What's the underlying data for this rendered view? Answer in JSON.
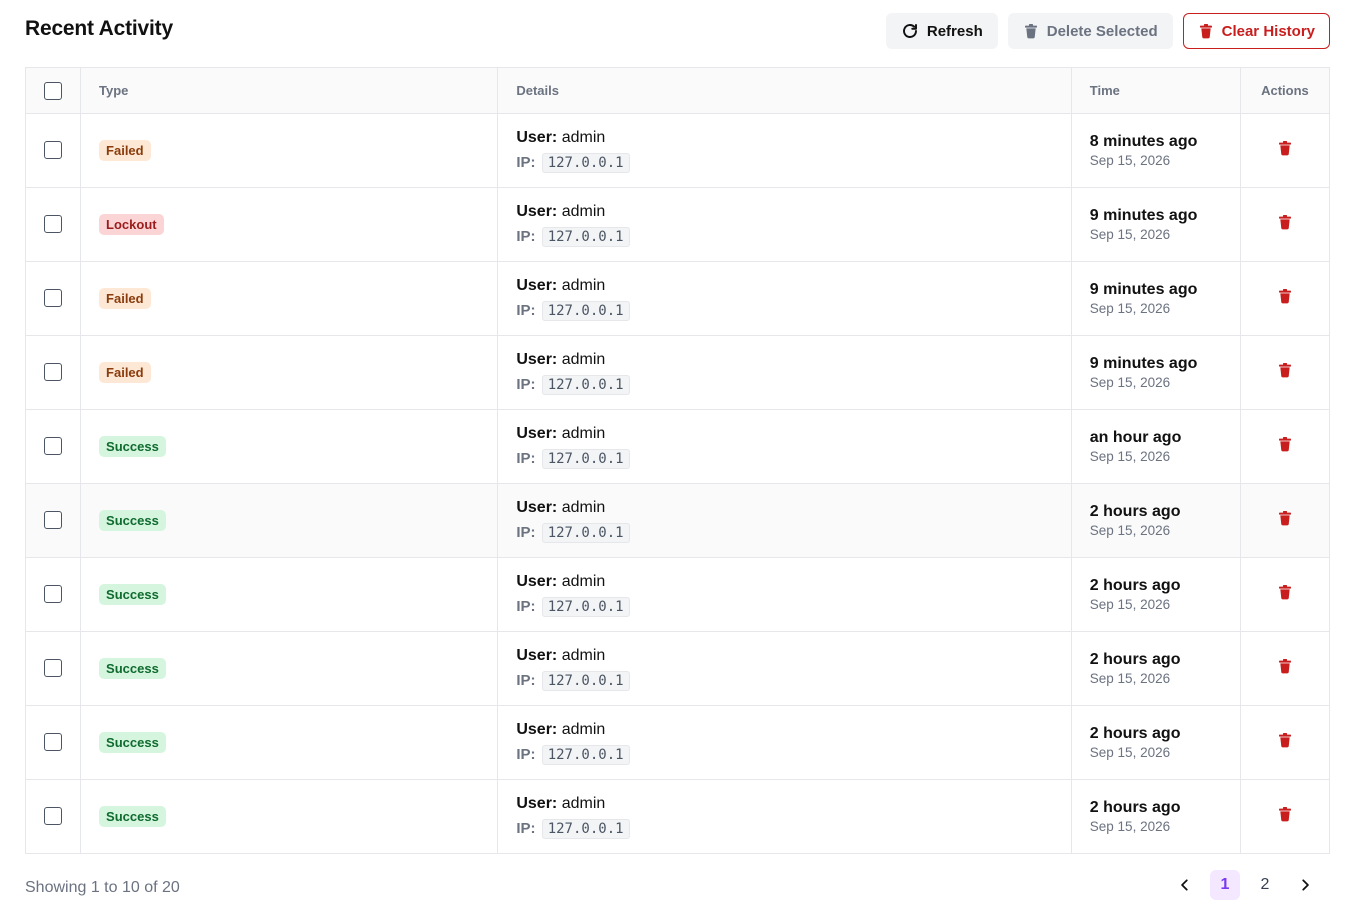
{
  "header": {
    "title": "Recent Activity",
    "refresh_label": "Refresh",
    "delete_selected_label": "Delete Selected",
    "clear_history_label": "Clear History"
  },
  "columns": {
    "type": "Type",
    "details": "Details",
    "time": "Time",
    "actions": "Actions"
  },
  "labels": {
    "user": "User:",
    "ip": "IP:"
  },
  "rows": [
    {
      "type": "Failed",
      "status": "failed",
      "user": "admin",
      "ip": "127.0.0.1",
      "relative": "8 minutes ago",
      "date": "Sep 15, 2026"
    },
    {
      "type": "Lockout",
      "status": "lockout",
      "user": "admin",
      "ip": "127.0.0.1",
      "relative": "9 minutes ago",
      "date": "Sep 15, 2026"
    },
    {
      "type": "Failed",
      "status": "failed",
      "user": "admin",
      "ip": "127.0.0.1",
      "relative": "9 minutes ago",
      "date": "Sep 15, 2026"
    },
    {
      "type": "Failed",
      "status": "failed",
      "user": "admin",
      "ip": "127.0.0.1",
      "relative": "9 minutes ago",
      "date": "Sep 15, 2026"
    },
    {
      "type": "Success",
      "status": "success",
      "user": "admin",
      "ip": "127.0.0.1",
      "relative": "an hour ago",
      "date": "Sep 15, 2026"
    },
    {
      "type": "Success",
      "status": "success",
      "user": "admin",
      "ip": "127.0.0.1",
      "relative": "2 hours ago",
      "date": "Sep 15, 2026",
      "highlighted": true
    },
    {
      "type": "Success",
      "status": "success",
      "user": "admin",
      "ip": "127.0.0.1",
      "relative": "2 hours ago",
      "date": "Sep 15, 2026"
    },
    {
      "type": "Success",
      "status": "success",
      "user": "admin",
      "ip": "127.0.0.1",
      "relative": "2 hours ago",
      "date": "Sep 15, 2026"
    },
    {
      "type": "Success",
      "status": "success",
      "user": "admin",
      "ip": "127.0.0.1",
      "relative": "2 hours ago",
      "date": "Sep 15, 2026"
    },
    {
      "type": "Success",
      "status": "success",
      "user": "admin",
      "ip": "127.0.0.1",
      "relative": "2 hours ago",
      "date": "Sep 15, 2026"
    }
  ],
  "footer": {
    "showing": "Showing 1 to 10 of 20",
    "pages": [
      "1",
      "2"
    ],
    "current_page": "1"
  },
  "colors": {
    "danger": "#c81e1e",
    "accent": "#7c3aed",
    "failed_bg": "#fde8d5",
    "lockout_bg": "#fbd5d5",
    "success_bg": "#d6f5df"
  },
  "icons": {
    "refresh": "refresh-icon",
    "delete": "trash-icon",
    "prev": "chevron-left-icon",
    "next": "chevron-right-icon"
  }
}
